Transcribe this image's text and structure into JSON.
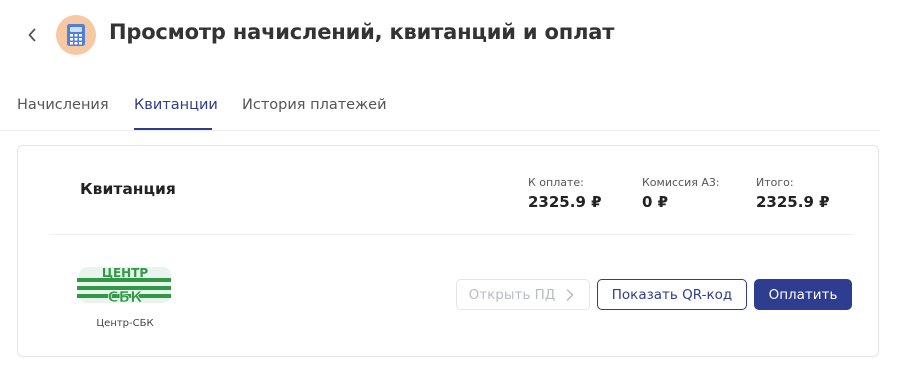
{
  "header": {
    "title": "Просмотр начислений, квитанций и оплат",
    "back_icon": "chevron-left-icon",
    "app_icon": "calculator-icon",
    "app_icon_bg": "#f6c9a2"
  },
  "tabs": [
    {
      "label": "Начисления",
      "active": false
    },
    {
      "label": "Квитанции",
      "active": true
    },
    {
      "label": "История платежей",
      "active": false
    }
  ],
  "card": {
    "title": "Квитанция",
    "summary": [
      {
        "label": "К оплате:",
        "value": "2325.9 ₽"
      },
      {
        "label": "Комиссия A3:",
        "value": "0 ₽"
      },
      {
        "label": "Итого:",
        "value": "2325.9 ₽"
      }
    ],
    "provider": {
      "logo_text": "ЦЕНТР СБК",
      "caption": "Центр-СБК"
    },
    "buttons": {
      "open_pd": "Открыть ПД",
      "show_qr": "Показать QR-код",
      "pay": "Оплатить"
    }
  },
  "colors": {
    "accent": "#2e3d8f",
    "logo_green": "#2f9a46"
  }
}
